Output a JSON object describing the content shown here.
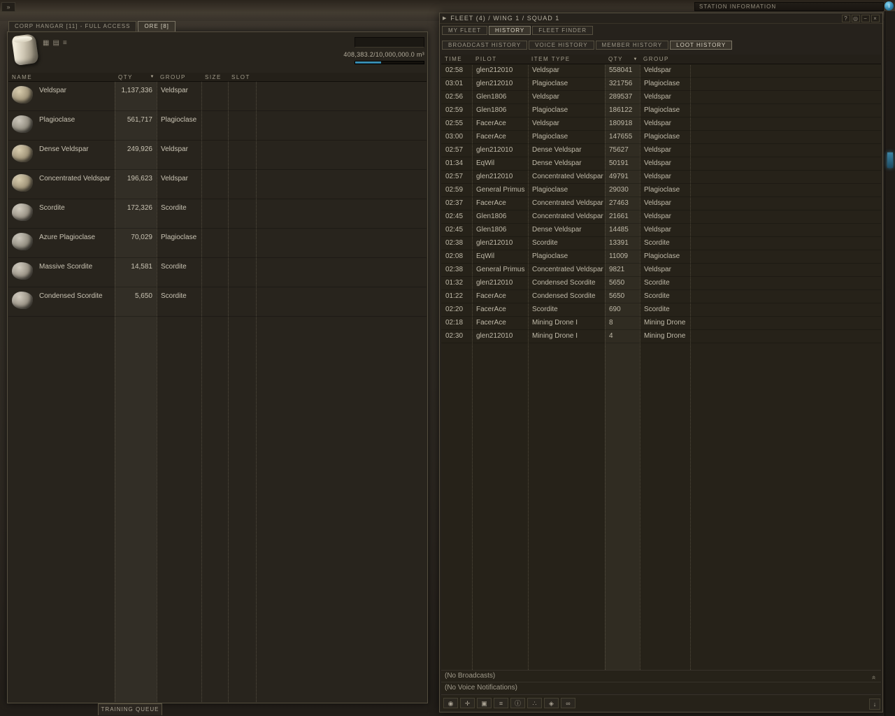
{
  "page": {
    "expander_glyph": "»",
    "station_bar": {
      "title": "STATION INFORMATION",
      "info_glyph": "i"
    }
  },
  "glyphs": {
    "sort_desc": "▼",
    "collapse_triangle": "▶",
    "chevron_collapse": "»",
    "scroll_down": "↓"
  },
  "colors": {
    "accent_blue": "#3f8fb4"
  },
  "hangar": {
    "tabs": [
      {
        "label": "CORP HANGAR [11] - FULL ACCESS",
        "active": false
      },
      {
        "label": "ORE [8]",
        "active": true
      }
    ],
    "view_glyphs": [
      "▦",
      "▤",
      "≡"
    ],
    "search_value": "",
    "capacity_text": "408,383.2/10,000,000.0 m³",
    "capacity_fill_pct": 38,
    "columns": {
      "name": "NAME",
      "qty": "QTY",
      "group": "GROUP",
      "size": "SIZE",
      "slot": "SLOT"
    },
    "rows": [
      {
        "name": "Veldspar",
        "qty": "1,137,336",
        "group": "Veldspar"
      },
      {
        "name": "Plagioclase",
        "qty": "561,717",
        "group": "Plagioclase"
      },
      {
        "name": "Dense Veldspar",
        "qty": "249,926",
        "group": "Veldspar"
      },
      {
        "name": "Concentrated Veldspar",
        "qty": "196,623",
        "group": "Veldspar"
      },
      {
        "name": "Scordite",
        "qty": "172,326",
        "group": "Scordite"
      },
      {
        "name": "Azure Plagioclase",
        "qty": "70,029",
        "group": "Plagioclase"
      },
      {
        "name": "Massive Scordite",
        "qty": "14,581",
        "group": "Scordite"
      },
      {
        "name": "Condensed Scordite",
        "qty": "5,650",
        "group": "Scordite"
      }
    ],
    "bottom_tab": "TRAINING QUEUE"
  },
  "fleet": {
    "title": "FLEET (4) / WING 1 / SQUAD 1",
    "window_buttons": [
      {
        "name": "help-button",
        "glyph": "?"
      },
      {
        "name": "pin-button",
        "glyph": "◎"
      },
      {
        "name": "minimize-button",
        "glyph": "−"
      },
      {
        "name": "close-button",
        "glyph": "×"
      }
    ],
    "tabs": [
      {
        "label": "MY FLEET",
        "active": false
      },
      {
        "label": "HISTORY",
        "active": true
      },
      {
        "label": "FLEET FINDER",
        "active": false
      }
    ],
    "subtabs": [
      {
        "label": "BROADCAST HISTORY",
        "active": false
      },
      {
        "label": "VOICE HISTORY",
        "active": false
      },
      {
        "label": "MEMBER HISTORY",
        "active": false
      },
      {
        "label": "LOOT HISTORY",
        "active": true
      }
    ],
    "columns": {
      "time": "TIME",
      "pilot": "PILOT",
      "item": "ITEM TYPE",
      "qty": "QTY",
      "group": "GROUP"
    },
    "rows": [
      {
        "time": "02:58",
        "pilot": "glen212010",
        "item": "Veldspar",
        "qty": "558041",
        "group": "Veldspar"
      },
      {
        "time": "03:01",
        "pilot": "glen212010",
        "item": "Plagioclase",
        "qty": "321756",
        "group": "Plagioclase"
      },
      {
        "time": "02:56",
        "pilot": "Glen1806",
        "item": "Veldspar",
        "qty": "289537",
        "group": "Veldspar"
      },
      {
        "time": "02:59",
        "pilot": "Glen1806",
        "item": "Plagioclase",
        "qty": "186122",
        "group": "Plagioclase"
      },
      {
        "time": "02:55",
        "pilot": "FacerAce",
        "item": "Veldspar",
        "qty": "180918",
        "group": "Veldspar"
      },
      {
        "time": "03:00",
        "pilot": "FacerAce",
        "item": "Plagioclase",
        "qty": "147655",
        "group": "Plagioclase"
      },
      {
        "time": "02:57",
        "pilot": "glen212010",
        "item": "Dense Veldspar",
        "qty": "75627",
        "group": "Veldspar"
      },
      {
        "time": "01:34",
        "pilot": "EqWil",
        "item": "Dense Veldspar",
        "qty": "50191",
        "group": "Veldspar"
      },
      {
        "time": "02:57",
        "pilot": "glen212010",
        "item": "Concentrated Veldspar",
        "qty": "49791",
        "group": "Veldspar"
      },
      {
        "time": "02:59",
        "pilot": "General Primus",
        "item": "Plagioclase",
        "qty": "29030",
        "group": "Plagioclase"
      },
      {
        "time": "02:37",
        "pilot": "FacerAce",
        "item": "Concentrated Veldspar",
        "qty": "27463",
        "group": "Veldspar"
      },
      {
        "time": "02:45",
        "pilot": "Glen1806",
        "item": "Concentrated Veldspar",
        "qty": "21661",
        "group": "Veldspar"
      },
      {
        "time": "02:45",
        "pilot": "Glen1806",
        "item": "Dense Veldspar",
        "qty": "14485",
        "group": "Veldspar"
      },
      {
        "time": "02:38",
        "pilot": "glen212010",
        "item": "Scordite",
        "qty": "13391",
        "group": "Scordite"
      },
      {
        "time": "02:08",
        "pilot": "EqWil",
        "item": "Plagioclase",
        "qty": "11009",
        "group": "Plagioclase"
      },
      {
        "time": "02:38",
        "pilot": "General Primus",
        "item": "Concentrated Veldspar",
        "qty": "9821",
        "group": "Veldspar"
      },
      {
        "time": "01:32",
        "pilot": "glen212010",
        "item": "Condensed Scordite",
        "qty": "5650",
        "group": "Scordite"
      },
      {
        "time": "01:22",
        "pilot": "FacerAce",
        "item": "Condensed Scordite",
        "qty": "5650",
        "group": "Scordite"
      },
      {
        "time": "02:20",
        "pilot": "FacerAce",
        "item": "Scordite",
        "qty": "690",
        "group": "Scordite"
      },
      {
        "time": "02:18",
        "pilot": "FacerAce",
        "item": "Mining Drone I",
        "qty": "8",
        "group": "Mining Drone"
      },
      {
        "time": "02:30",
        "pilot": "glen212010",
        "item": "Mining Drone I",
        "qty": "4",
        "group": "Mining Drone"
      }
    ],
    "status_lines": [
      "(No Broadcasts)",
      "(No Voice Notifications)"
    ],
    "toolbar_icons": [
      {
        "name": "broadcast-eye-icon",
        "glyph": "◉"
      },
      {
        "name": "broadcast-target-icon",
        "glyph": "✛"
      },
      {
        "name": "broadcast-loot-icon",
        "glyph": "▣"
      },
      {
        "name": "broadcast-hold-icon",
        "glyph": "≡"
      },
      {
        "name": "broadcast-info-icon",
        "glyph": "ⓘ"
      },
      {
        "name": "broadcast-travel-icon",
        "glyph": "∴"
      },
      {
        "name": "broadcast-capacitor-icon",
        "glyph": "◈"
      },
      {
        "name": "broadcast-share-icon",
        "glyph": "∞"
      }
    ]
  }
}
